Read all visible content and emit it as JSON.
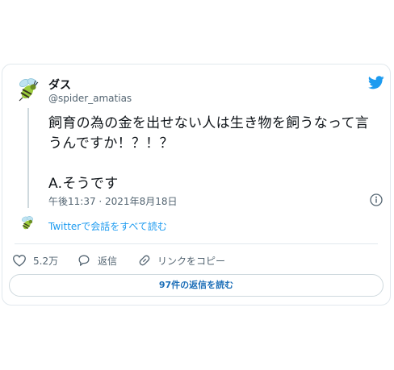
{
  "author": {
    "name": "ダス",
    "handle": "@spider_amatias"
  },
  "tweet": {
    "text": "飼育の為の金を出せない人は生き物を飼うなって言うんですか！？！？\n\nA.そうです",
    "timestamp": "午後11:37 · 2021年8月18日"
  },
  "thread": {
    "read_link": "Twitterで会話をすべて読む"
  },
  "actions": {
    "likes": "5.2万",
    "reply_label": "返信",
    "copy_link_label": "リンクをコピー"
  },
  "footer": {
    "replies_button_label": "97件の返信を読む"
  },
  "colors": {
    "accent": "#1d9bf0",
    "muted_text": "#536471",
    "border": "#e1e8ed"
  },
  "icons": [
    "bee-avatar-icon",
    "twitter-bird-icon",
    "info-icon",
    "heart-icon",
    "reply-bubble-icon",
    "link-icon"
  ]
}
